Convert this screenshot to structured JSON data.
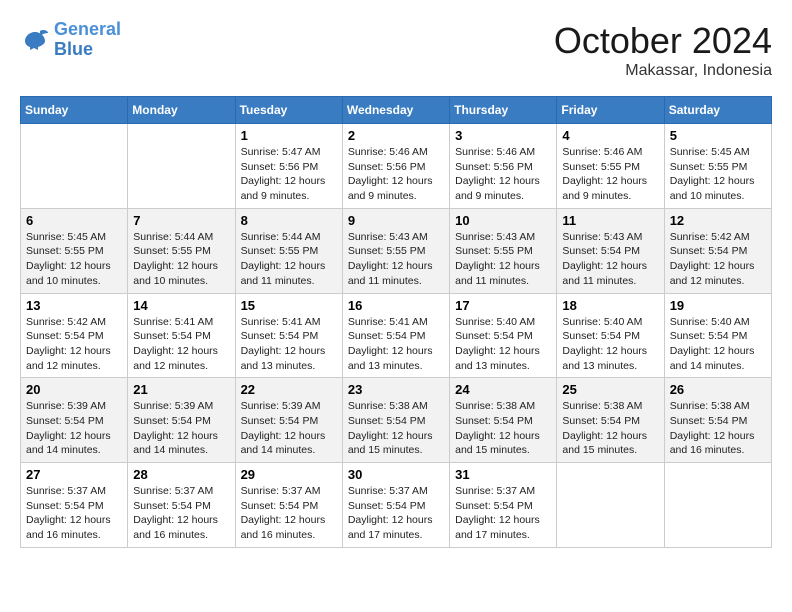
{
  "header": {
    "logo_line1": "General",
    "logo_line2": "Blue",
    "month": "October 2024",
    "location": "Makassar, Indonesia"
  },
  "weekdays": [
    "Sunday",
    "Monday",
    "Tuesday",
    "Wednesday",
    "Thursday",
    "Friday",
    "Saturday"
  ],
  "weeks": [
    [
      {
        "day": "",
        "info": ""
      },
      {
        "day": "",
        "info": ""
      },
      {
        "day": "1",
        "info": "Sunrise: 5:47 AM\nSunset: 5:56 PM\nDaylight: 12 hours and 9 minutes."
      },
      {
        "day": "2",
        "info": "Sunrise: 5:46 AM\nSunset: 5:56 PM\nDaylight: 12 hours and 9 minutes."
      },
      {
        "day": "3",
        "info": "Sunrise: 5:46 AM\nSunset: 5:56 PM\nDaylight: 12 hours and 9 minutes."
      },
      {
        "day": "4",
        "info": "Sunrise: 5:46 AM\nSunset: 5:55 PM\nDaylight: 12 hours and 9 minutes."
      },
      {
        "day": "5",
        "info": "Sunrise: 5:45 AM\nSunset: 5:55 PM\nDaylight: 12 hours and 10 minutes."
      }
    ],
    [
      {
        "day": "6",
        "info": "Sunrise: 5:45 AM\nSunset: 5:55 PM\nDaylight: 12 hours and 10 minutes."
      },
      {
        "day": "7",
        "info": "Sunrise: 5:44 AM\nSunset: 5:55 PM\nDaylight: 12 hours and 10 minutes."
      },
      {
        "day": "8",
        "info": "Sunrise: 5:44 AM\nSunset: 5:55 PM\nDaylight: 12 hours and 11 minutes."
      },
      {
        "day": "9",
        "info": "Sunrise: 5:43 AM\nSunset: 5:55 PM\nDaylight: 12 hours and 11 minutes."
      },
      {
        "day": "10",
        "info": "Sunrise: 5:43 AM\nSunset: 5:55 PM\nDaylight: 12 hours and 11 minutes."
      },
      {
        "day": "11",
        "info": "Sunrise: 5:43 AM\nSunset: 5:54 PM\nDaylight: 12 hours and 11 minutes."
      },
      {
        "day": "12",
        "info": "Sunrise: 5:42 AM\nSunset: 5:54 PM\nDaylight: 12 hours and 12 minutes."
      }
    ],
    [
      {
        "day": "13",
        "info": "Sunrise: 5:42 AM\nSunset: 5:54 PM\nDaylight: 12 hours and 12 minutes."
      },
      {
        "day": "14",
        "info": "Sunrise: 5:41 AM\nSunset: 5:54 PM\nDaylight: 12 hours and 12 minutes."
      },
      {
        "day": "15",
        "info": "Sunrise: 5:41 AM\nSunset: 5:54 PM\nDaylight: 12 hours and 13 minutes."
      },
      {
        "day": "16",
        "info": "Sunrise: 5:41 AM\nSunset: 5:54 PM\nDaylight: 12 hours and 13 minutes."
      },
      {
        "day": "17",
        "info": "Sunrise: 5:40 AM\nSunset: 5:54 PM\nDaylight: 12 hours and 13 minutes."
      },
      {
        "day": "18",
        "info": "Sunrise: 5:40 AM\nSunset: 5:54 PM\nDaylight: 12 hours and 13 minutes."
      },
      {
        "day": "19",
        "info": "Sunrise: 5:40 AM\nSunset: 5:54 PM\nDaylight: 12 hours and 14 minutes."
      }
    ],
    [
      {
        "day": "20",
        "info": "Sunrise: 5:39 AM\nSunset: 5:54 PM\nDaylight: 12 hours and 14 minutes."
      },
      {
        "day": "21",
        "info": "Sunrise: 5:39 AM\nSunset: 5:54 PM\nDaylight: 12 hours and 14 minutes."
      },
      {
        "day": "22",
        "info": "Sunrise: 5:39 AM\nSunset: 5:54 PM\nDaylight: 12 hours and 14 minutes."
      },
      {
        "day": "23",
        "info": "Sunrise: 5:38 AM\nSunset: 5:54 PM\nDaylight: 12 hours and 15 minutes."
      },
      {
        "day": "24",
        "info": "Sunrise: 5:38 AM\nSunset: 5:54 PM\nDaylight: 12 hours and 15 minutes."
      },
      {
        "day": "25",
        "info": "Sunrise: 5:38 AM\nSunset: 5:54 PM\nDaylight: 12 hours and 15 minutes."
      },
      {
        "day": "26",
        "info": "Sunrise: 5:38 AM\nSunset: 5:54 PM\nDaylight: 12 hours and 16 minutes."
      }
    ],
    [
      {
        "day": "27",
        "info": "Sunrise: 5:37 AM\nSunset: 5:54 PM\nDaylight: 12 hours and 16 minutes."
      },
      {
        "day": "28",
        "info": "Sunrise: 5:37 AM\nSunset: 5:54 PM\nDaylight: 12 hours and 16 minutes."
      },
      {
        "day": "29",
        "info": "Sunrise: 5:37 AM\nSunset: 5:54 PM\nDaylight: 12 hours and 16 minutes."
      },
      {
        "day": "30",
        "info": "Sunrise: 5:37 AM\nSunset: 5:54 PM\nDaylight: 12 hours and 17 minutes."
      },
      {
        "day": "31",
        "info": "Sunrise: 5:37 AM\nSunset: 5:54 PM\nDaylight: 12 hours and 17 minutes."
      },
      {
        "day": "",
        "info": ""
      },
      {
        "day": "",
        "info": ""
      }
    ]
  ]
}
